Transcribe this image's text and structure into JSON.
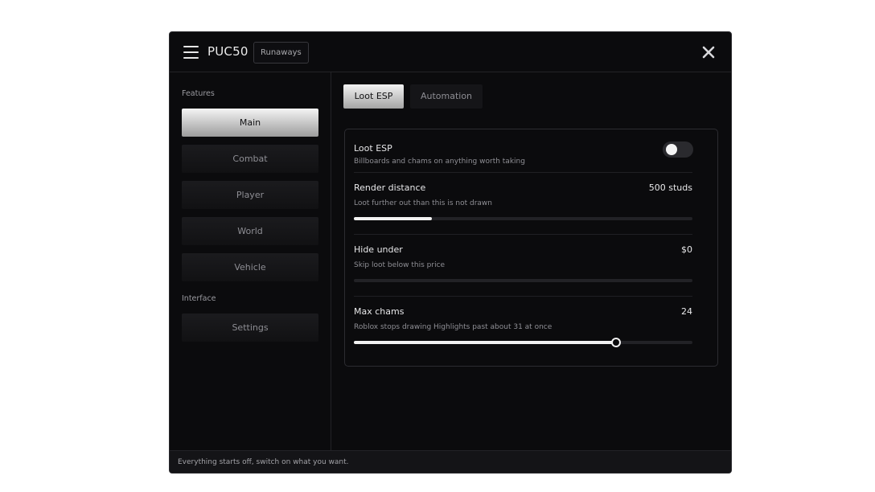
{
  "header": {
    "title": "PUC50",
    "game_badge": "Runaways"
  },
  "sidebar": {
    "sections": [
      {
        "label": "Features",
        "items": [
          {
            "label": "Main",
            "active": true
          },
          {
            "label": "Combat",
            "active": false
          },
          {
            "label": "Player",
            "active": false
          },
          {
            "label": "World",
            "active": false
          },
          {
            "label": "Vehicle",
            "active": false
          }
        ]
      },
      {
        "label": "Interface",
        "items": [
          {
            "label": "Settings",
            "active": false
          }
        ]
      }
    ]
  },
  "tabs": [
    {
      "label": "Loot ESP",
      "active": true
    },
    {
      "label": "Automation",
      "active": false
    }
  ],
  "settings": [
    {
      "type": "toggle",
      "title": "Loot ESP",
      "description": "Billboards and chams on anything worth taking",
      "enabled": false
    },
    {
      "type": "slider",
      "title": "Render distance",
      "description": "Loot further out than this is not drawn",
      "value": "500 studs",
      "fill_fraction": 0.23
    },
    {
      "type": "slider",
      "title": "Hide under",
      "description": "Skip loot below this price",
      "value": "$0",
      "fill_fraction": 0
    },
    {
      "type": "slider",
      "title": "Max chams",
      "description": "Roblox stops drawing Highlights past about 31 at once",
      "value": "24",
      "fill_fraction": 0.775
    }
  ],
  "status": {
    "text": "Everything starts off, switch on what you want."
  },
  "colors": {
    "background": "#0b0b0d",
    "accent": "#f2f2f2",
    "muted_text": "#8e8e94"
  }
}
